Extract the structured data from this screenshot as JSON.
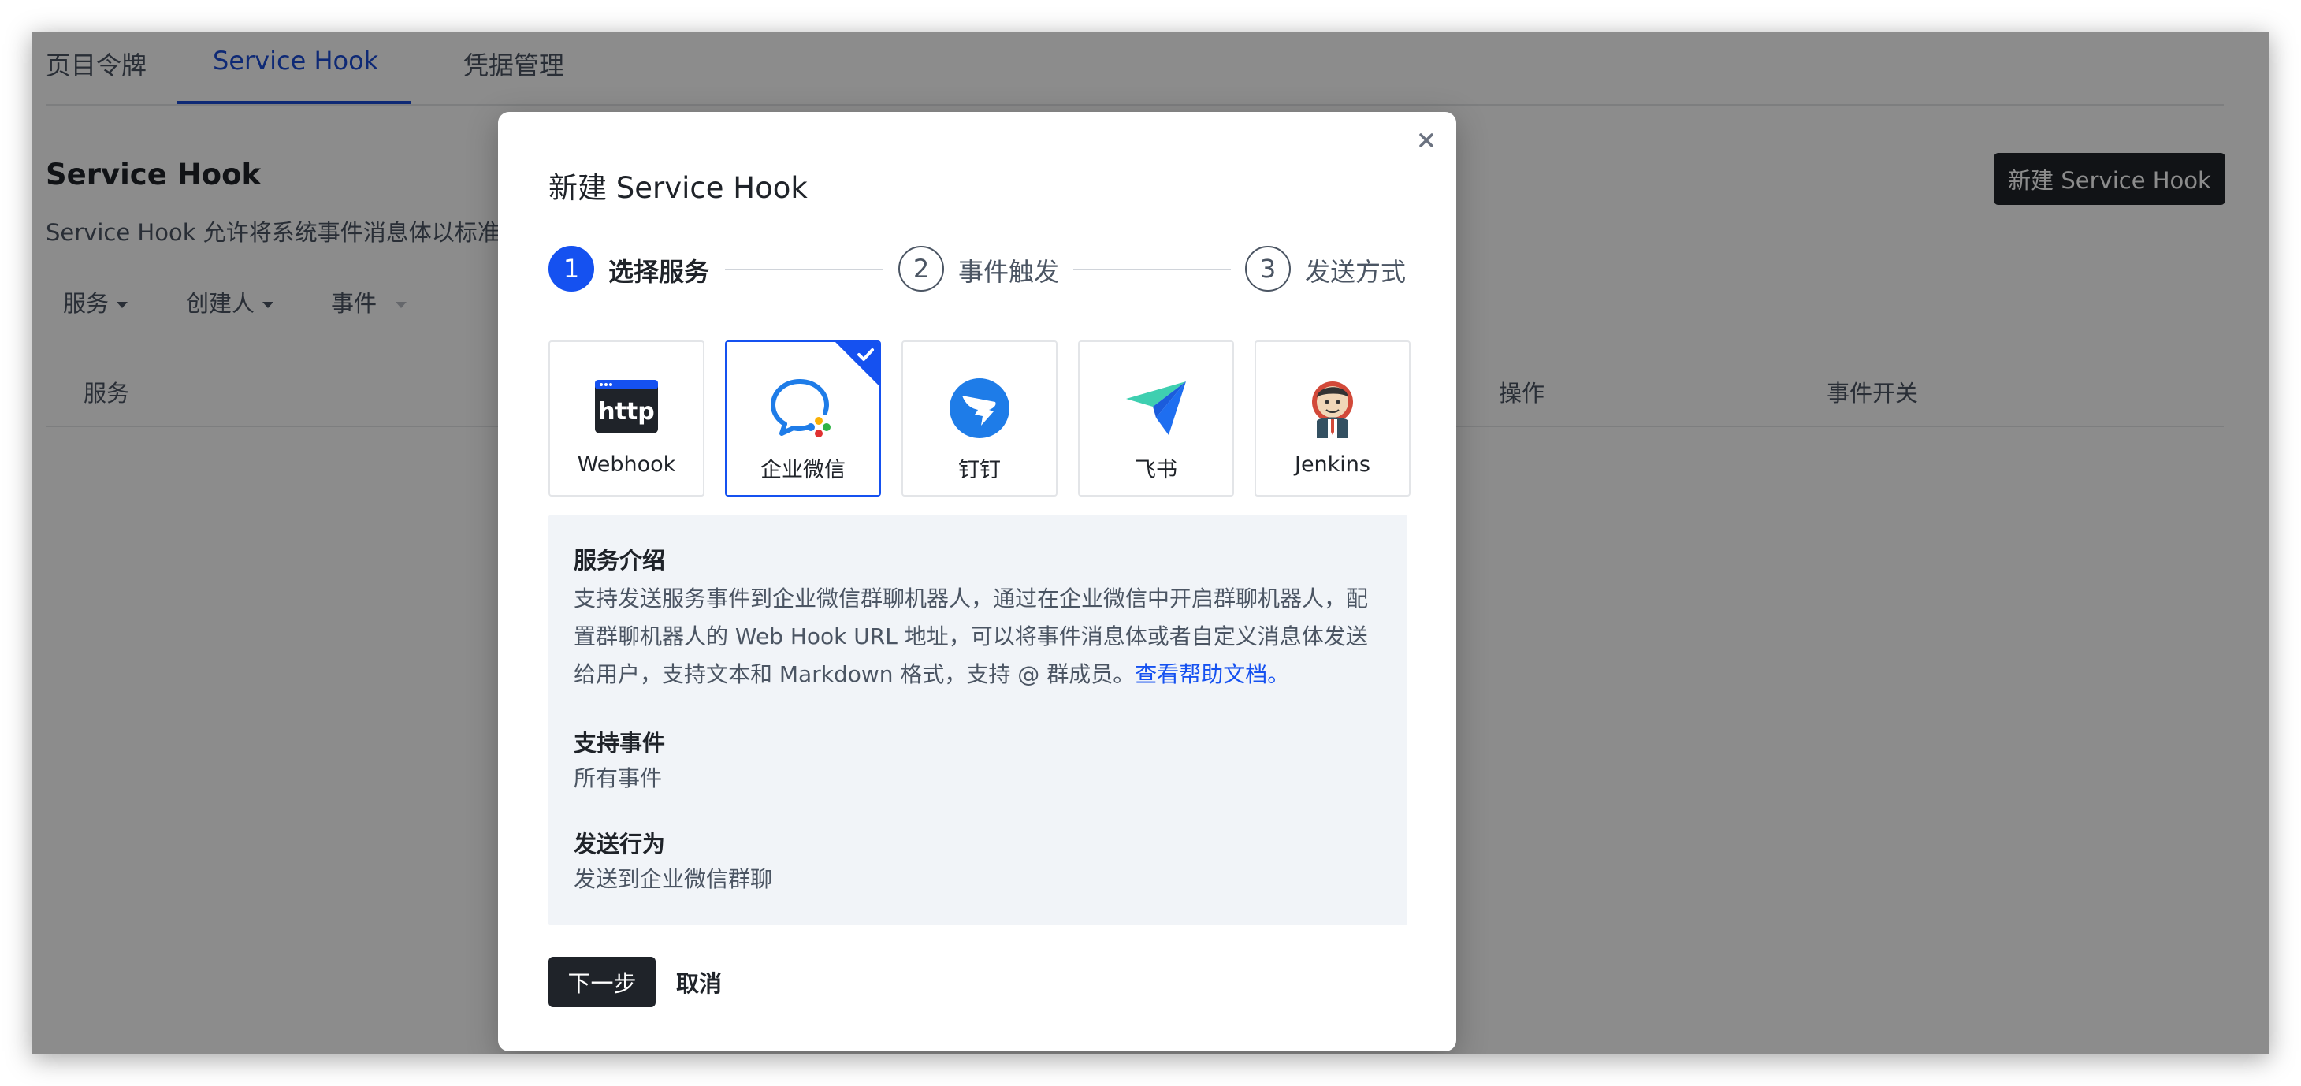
{
  "tabs": [
    {
      "label": "页目令牌",
      "active": false
    },
    {
      "label": "Service Hook",
      "active": true
    },
    {
      "label": "凭据管理",
      "active": false
    }
  ],
  "page": {
    "title": "Service Hook",
    "description": "Service Hook 允许将系统事件消息体以标准",
    "new_button": "新建 Service Hook"
  },
  "filters": [
    {
      "label": "服务"
    },
    {
      "label": "创建人"
    },
    {
      "label": "事件"
    }
  ],
  "table": {
    "headers": [
      "服务",
      "操作",
      "事件开关"
    ]
  },
  "modal": {
    "title": "新建 Service Hook",
    "steps": [
      {
        "number": "1",
        "label": "选择服务",
        "active": true
      },
      {
        "number": "2",
        "label": "事件触发",
        "active": false
      },
      {
        "number": "3",
        "label": "发送方式",
        "active": false
      }
    ],
    "services": [
      {
        "label": "Webhook",
        "icon": "http-icon",
        "logo_text": "http",
        "selected": false
      },
      {
        "label": "企业微信",
        "icon": "wecom-icon",
        "selected": true
      },
      {
        "label": "钉钉",
        "icon": "dingtalk-icon",
        "selected": false
      },
      {
        "label": "飞书",
        "icon": "feishu-icon",
        "selected": false
      },
      {
        "label": "Jenkins",
        "icon": "jenkins-icon",
        "selected": false
      }
    ],
    "info": {
      "intro_title": "服务介绍",
      "intro_text": "支持发送服务事件到企业微信群聊机器人，通过在企业微信中开启群聊机器人，配置群聊机器人的 Web Hook URL 地址，可以将事件消息体或者自定义消息体发送给用户，支持文本和 Markdown 格式，支持 @ 群成员。",
      "help_link": "查看帮助文档。",
      "events_title": "支持事件",
      "events_value": "所有事件",
      "action_title": "发送行为",
      "action_value": "发送到企业微信群聊"
    },
    "next_button": "下一步",
    "cancel_button": "取消"
  },
  "colors": {
    "accent": "#1551f0",
    "dark": "#1f2329",
    "info_bg": "#f1f4f8"
  }
}
